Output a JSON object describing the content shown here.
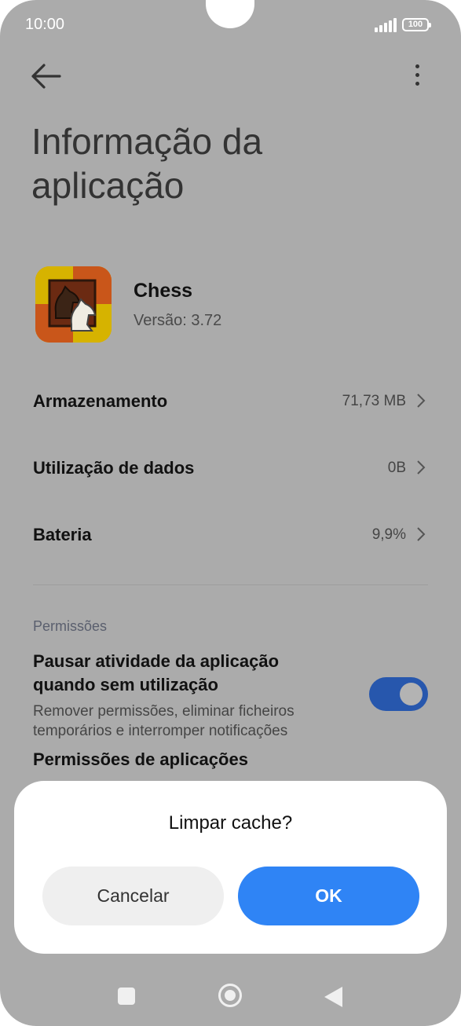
{
  "status_bar": {
    "time": "10:00",
    "battery": "100"
  },
  "header": {
    "title": "Informação da aplicação"
  },
  "app": {
    "name": "Chess",
    "version": "Versão: 3.72"
  },
  "rows": [
    {
      "label": "Armazenamento",
      "value": "71,73 MB"
    },
    {
      "label": "Utilização de dados",
      "value": "0B"
    },
    {
      "label": "Bateria",
      "value": "9,9%"
    }
  ],
  "permissions": {
    "section_label": "Permissões",
    "pause_title": "Pausar atividade da aplicação quando sem utilização",
    "pause_subtitle": "Remover permissões, eliminar ficheiros temporários e interromper notificações",
    "pause_enabled": true,
    "app_permissions_title": "Permissões de aplicações"
  },
  "dialog": {
    "title": "Limpar cache?",
    "cancel_label": "Cancelar",
    "ok_label": "OK"
  },
  "colors": {
    "toggle_on": "#2757ad",
    "ok_button": "#2f84f5",
    "overlay": "#ababab"
  },
  "icons": [
    "back-arrow-icon",
    "more-vert-icon",
    "chevron-right-icon",
    "chess-knight-icon",
    "signal-icon",
    "battery-icon",
    "nav-recents-icon",
    "nav-home-icon",
    "nav-back-icon"
  ]
}
